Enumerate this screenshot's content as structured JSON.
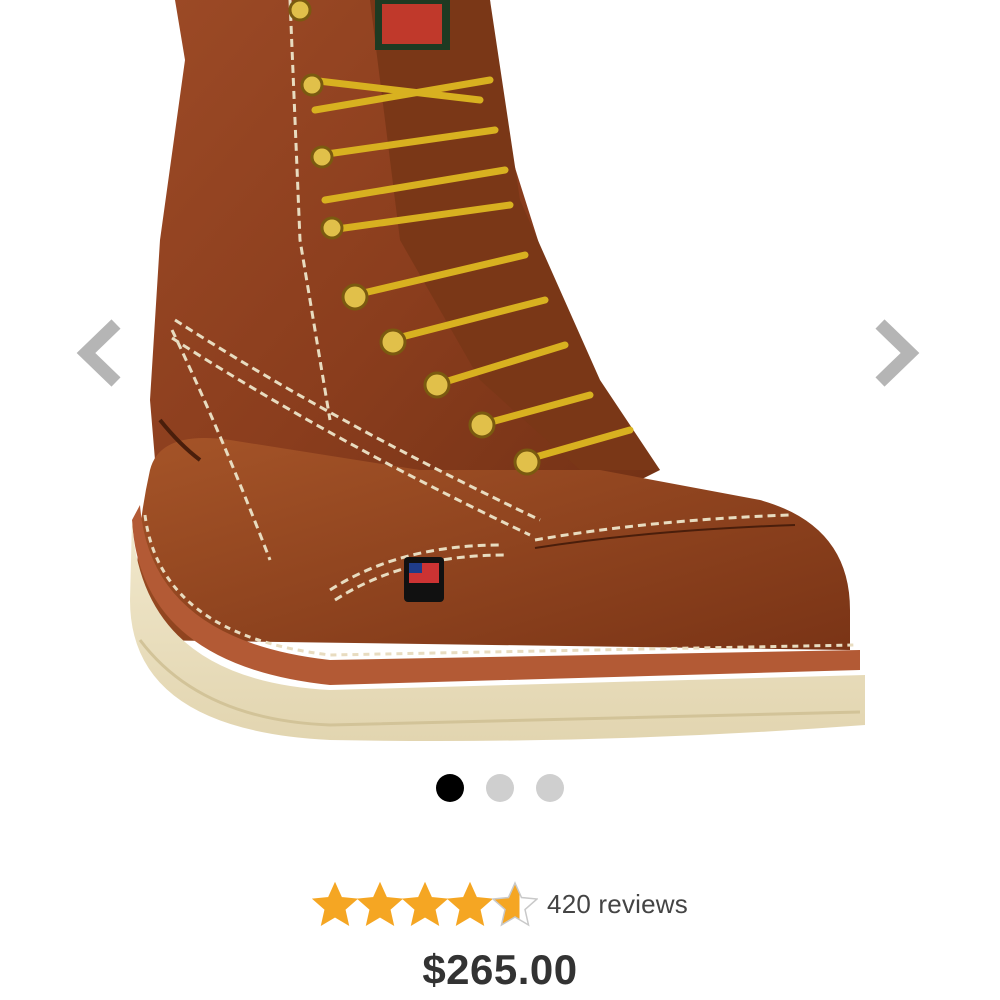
{
  "product": {
    "image_alt": "brown leather moc toe work boot",
    "image_count": 3,
    "active_image": 1,
    "rating": 4.6,
    "rating_max": 5,
    "review_count_label": "420 reviews",
    "price": "$265.00"
  },
  "carousel": {
    "prev_icon": "chevron-left-icon",
    "next_icon": "chevron-right-icon",
    "arrow_color": "#b5b5b5"
  },
  "colors": {
    "star": "#f5a623",
    "star_empty": "#c9c9c9",
    "dot_active": "#000000",
    "dot_inactive": "#cfcfcf"
  }
}
